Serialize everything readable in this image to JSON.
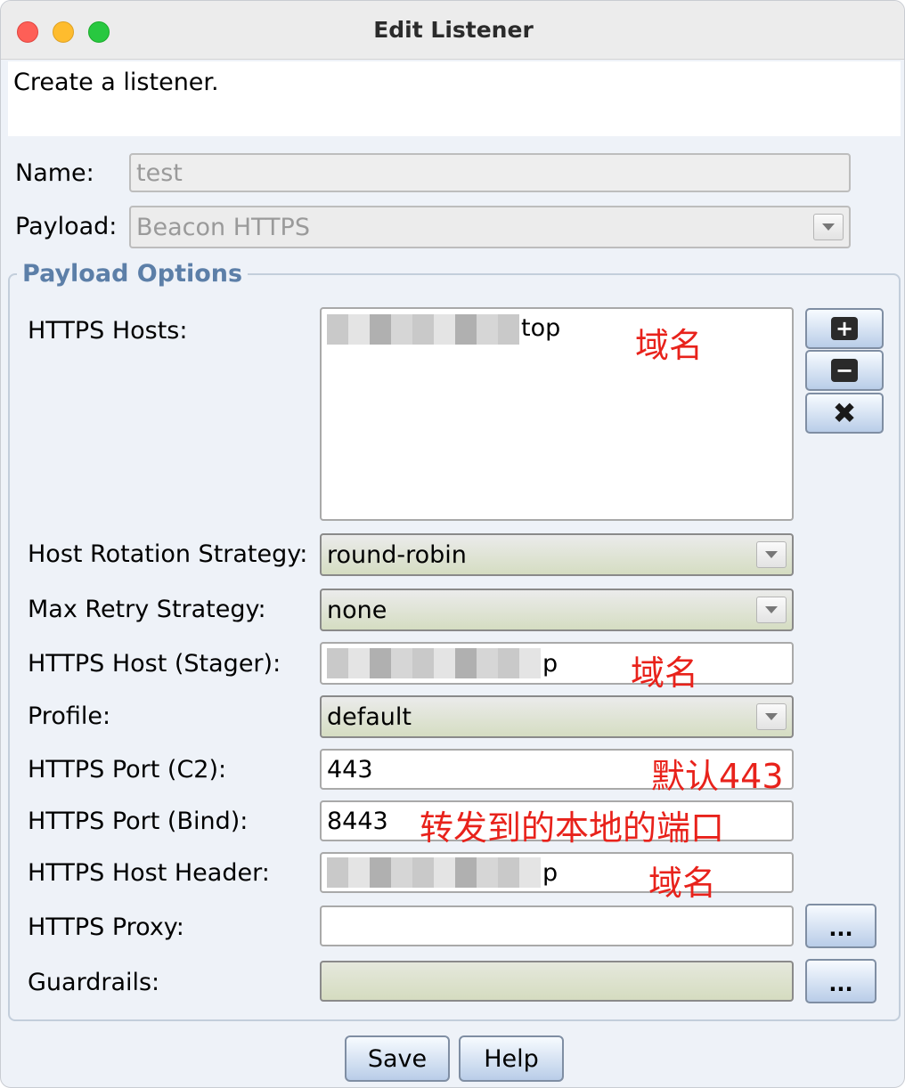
{
  "window": {
    "title": "Edit Listener"
  },
  "description": "Create a listener.",
  "name": {
    "label": "Name:",
    "value": "test"
  },
  "payload": {
    "label": "Payload:",
    "value": "Beacon HTTPS"
  },
  "payload_options": {
    "title": "Payload Options",
    "https_hosts": {
      "label": "HTTPS Hosts:",
      "value_suffix": "top"
    },
    "host_rotation": {
      "label": "Host Rotation Strategy:",
      "value": "round-robin"
    },
    "max_retry": {
      "label": "Max Retry Strategy:",
      "value": "none"
    },
    "host_stager": {
      "label": "HTTPS Host (Stager):",
      "value_suffix": "p"
    },
    "profile": {
      "label": "Profile:",
      "value": "default"
    },
    "port_c2": {
      "label": "HTTPS Port (C2):",
      "value": "443"
    },
    "port_bind": {
      "label": "HTTPS Port (Bind):",
      "value": "8443"
    },
    "host_header": {
      "label": "HTTPS Host Header:",
      "value_suffix": "p"
    },
    "proxy": {
      "label": "HTTPS Proxy:",
      "value": "",
      "browse": "..."
    },
    "guardrails": {
      "label": "Guardrails:",
      "value": "",
      "browse": "..."
    }
  },
  "host_buttons": {
    "add": "+",
    "remove": "−",
    "clear": "✖"
  },
  "annotations": {
    "hosts": "域名",
    "stager": "域名",
    "port_c2": "默认443",
    "port_bind": "转发到的本地的端口",
    "host_header": "域名"
  },
  "buttons": {
    "save": "Save",
    "help": "Help"
  }
}
